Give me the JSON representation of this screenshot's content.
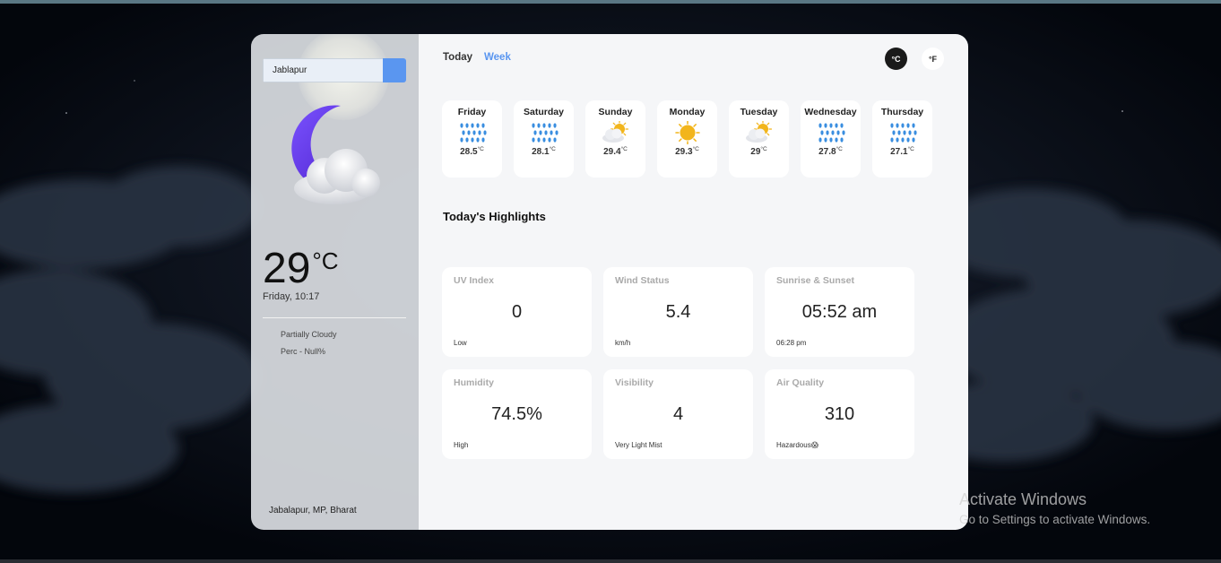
{
  "search": {
    "value": "Jablapur"
  },
  "current": {
    "temp": "29",
    "unit": "°C",
    "day_time": "Friday, 10:17",
    "condition": "Partially Cloudy",
    "precipitation": "Perc - Null%",
    "location": "Jabalapur, MP, Bharat",
    "icon": "moon-cloud-icon"
  },
  "tabs": [
    {
      "label": "Today"
    },
    {
      "label": "Week"
    }
  ],
  "units": {
    "celsius": "°C",
    "fahrenheit": "°F"
  },
  "week": [
    {
      "day": "Friday",
      "temp": "28.5",
      "unit": "°C",
      "icon": "rain-icon"
    },
    {
      "day": "Saturday",
      "temp": "28.1",
      "unit": "°C",
      "icon": "rain-icon"
    },
    {
      "day": "Sunday",
      "temp": "29.4",
      "unit": "°C",
      "icon": "partly-sunny-icon"
    },
    {
      "day": "Monday",
      "temp": "29.3",
      "unit": "°C",
      "icon": "sun-icon"
    },
    {
      "day": "Tuesday",
      "temp": "29",
      "unit": "°C",
      "icon": "partly-sunny-icon"
    },
    {
      "day": "Wednesday",
      "temp": "27.8",
      "unit": "°C",
      "icon": "rain-icon"
    },
    {
      "day": "Thursday",
      "temp": "27.1",
      "unit": "°C",
      "icon": "rain-icon"
    }
  ],
  "highlights": {
    "title": "Today's Highlights",
    "uv": {
      "label": "UV Index",
      "value": "0",
      "sub": "Low"
    },
    "wind": {
      "label": "Wind Status",
      "value": "5.4",
      "sub": "km/h"
    },
    "sun": {
      "label": "Sunrise & Sunset",
      "value": "05:52 am",
      "sub": "06:28 pm"
    },
    "humidity": {
      "label": "Humidity",
      "value": "74.5%",
      "sub": "High"
    },
    "visibility": {
      "label": "Visibility",
      "value": "4",
      "sub": "Very Light Mist"
    },
    "air": {
      "label": "Air Quality",
      "value": "310",
      "sub": "Hazardous😱"
    }
  },
  "watermark": {
    "title": "Activate Windows",
    "subtitle": "Go to Settings to activate Windows."
  },
  "colors": {
    "accent": "#5a96f0",
    "moon": "#6a3cf0",
    "rain": "#3a8ee0",
    "sun": "#f2b51c"
  }
}
